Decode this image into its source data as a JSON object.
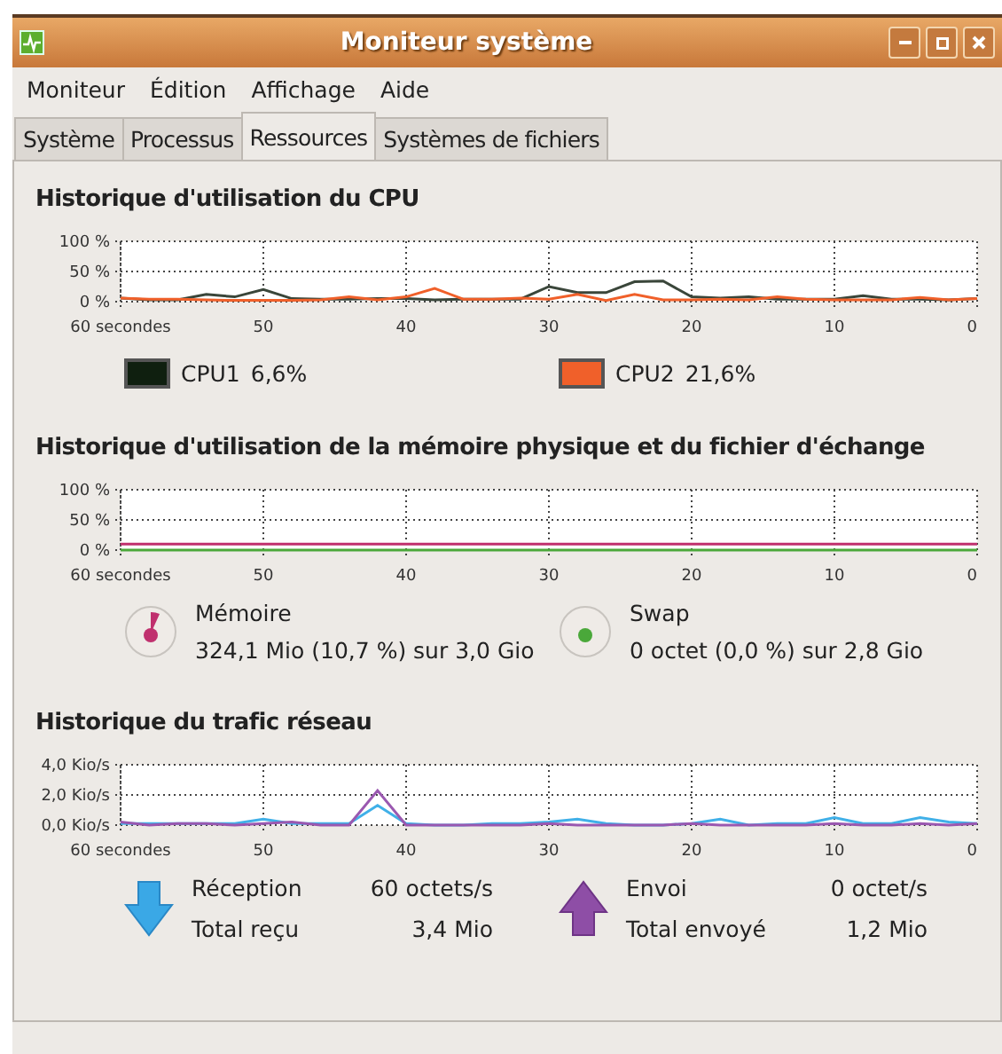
{
  "window": {
    "title": "Moniteur système"
  },
  "menu": [
    "Moniteur",
    "Édition",
    "Affichage",
    "Aide"
  ],
  "tabs": [
    {
      "label": "Système",
      "selected": false
    },
    {
      "label": "Processus",
      "selected": false
    },
    {
      "label": "Ressources",
      "selected": true
    },
    {
      "label": "Systèmes de fichiers",
      "selected": false
    }
  ],
  "cpu": {
    "title": "Historique d'utilisation du CPU",
    "chart_data": {
      "type": "line",
      "grid": true,
      "x": [
        60,
        58,
        56,
        54,
        52,
        50,
        48,
        46,
        44,
        42,
        40,
        38,
        36,
        34,
        32,
        30,
        28,
        26,
        24,
        22,
        20,
        18,
        16,
        14,
        12,
        10,
        8,
        6,
        4,
        2,
        0
      ],
      "xlim": [
        60,
        0
      ],
      "ylim": [
        0,
        100
      ],
      "xticks": [
        {
          "value": 60,
          "label": "60 secondes"
        },
        50,
        40,
        30,
        20,
        10,
        0
      ],
      "yticks": [
        {
          "value": 0,
          "label": "0 %"
        },
        {
          "value": 50,
          "label": "50 %"
        },
        {
          "value": 100,
          "label": "100 %"
        }
      ],
      "series": [
        {
          "name": "CPU1",
          "color": "#3a463a",
          "values": [
            6,
            3,
            3,
            12,
            8,
            20,
            5,
            4,
            4,
            5,
            5,
            3,
            4,
            4,
            4,
            25,
            15,
            15,
            33,
            34,
            8,
            6,
            8,
            4,
            4,
            4,
            10,
            4,
            4,
            3,
            5
          ]
        },
        {
          "name": "CPU2",
          "color": "#f0602a",
          "values": [
            6,
            4,
            4,
            3,
            2,
            2,
            2,
            3,
            8,
            3,
            8,
            22,
            4,
            4,
            6,
            4,
            12,
            2,
            12,
            3,
            3,
            4,
            3,
            8,
            4,
            3,
            3,
            3,
            7,
            3,
            5
          ]
        }
      ]
    },
    "legend": [
      {
        "value": "6,6%",
        "color": "#0f1f0f"
      },
      {
        "value": "21,6%",
        "color": "#f0602a"
      }
    ]
  },
  "memory": {
    "title": "Historique d'utilisation de la mémoire physique et du fichier d'échange",
    "chart_data": {
      "type": "line",
      "grid": true,
      "x": [
        60,
        0
      ],
      "xlim": [
        60,
        0
      ],
      "ylim": [
        0,
        100
      ],
      "xticks": [
        {
          "value": 60,
          "label": "60 secondes"
        },
        50,
        40,
        30,
        20,
        10,
        0
      ],
      "yticks": [
        {
          "value": 0,
          "label": "0 %"
        },
        {
          "value": 50,
          "label": "50 %"
        },
        {
          "value": 100,
          "label": "100 %"
        }
      ],
      "series": [
        {
          "name": "Mémoire",
          "color": "#c0306e",
          "values": [
            10,
            10
          ]
        },
        {
          "name": "Swap",
          "color": "#4aa83a",
          "values": [
            0,
            0
          ]
        }
      ]
    },
    "legend": [
      {
        "kind": "memory",
        "value": "324,1 Mio (10,7 %) sur 3,0 Gio",
        "color": "#c0306e"
      },
      {
        "kind": "swap",
        "value": "0 octet (0,0 %) sur 2,8 Gio",
        "color": "#4aa83a"
      }
    ]
  },
  "network": {
    "title": "Historique du trafic réseau",
    "chart_data": {
      "type": "line",
      "grid": true,
      "x": [
        60,
        58,
        56,
        54,
        52,
        50,
        48,
        46,
        44,
        42,
        40,
        38,
        36,
        34,
        32,
        30,
        28,
        26,
        24,
        22,
        20,
        18,
        16,
        14,
        12,
        10,
        8,
        6,
        4,
        2,
        0
      ],
      "xlim": [
        60,
        0
      ],
      "ylim": [
        0,
        4
      ],
      "xticks": [
        {
          "value": 60,
          "label": "60 secondes"
        },
        50,
        40,
        30,
        20,
        10,
        0
      ],
      "yticks": [
        {
          "value": 0,
          "label": "0,0 Kio/s"
        },
        {
          "value": 2,
          "label": "2,0 Kio/s"
        },
        {
          "value": 4,
          "label": "4,0 Kio/s"
        }
      ],
      "series": [
        {
          "name": "Réception",
          "color": "#40b0e8",
          "values": [
            0.1,
            0.1,
            0.1,
            0.1,
            0.1,
            0.4,
            0.1,
            0.1,
            0.1,
            1.3,
            0.1,
            0,
            0,
            0.1,
            0.1,
            0.2,
            0.4,
            0.1,
            0,
            0,
            0.1,
            0.4,
            0,
            0.1,
            0.1,
            0.5,
            0.1,
            0.1,
            0.5,
            0.2,
            0.1
          ]
        },
        {
          "name": "Envoi",
          "color": "#9a58b0",
          "values": [
            0.2,
            0,
            0.1,
            0.1,
            0,
            0.1,
            0.2,
            0,
            0,
            2.3,
            0,
            0,
            0,
            0,
            0,
            0.1,
            0,
            0,
            0,
            0,
            0.1,
            0,
            0,
            0,
            0,
            0.1,
            0,
            0,
            0.1,
            0,
            0.1
          ]
        }
      ]
    },
    "legend": [
      {
        "kind": "receive",
        "value": "60 octets/s",
        "total_label": "Total reçu",
        "total": "3,4 Mio"
      },
      {
        "kind": "send",
        "value": "0 octet/s",
        "total_label": "Total envoyé",
        "total": "1,2 Mio"
      }
    ]
  }
}
